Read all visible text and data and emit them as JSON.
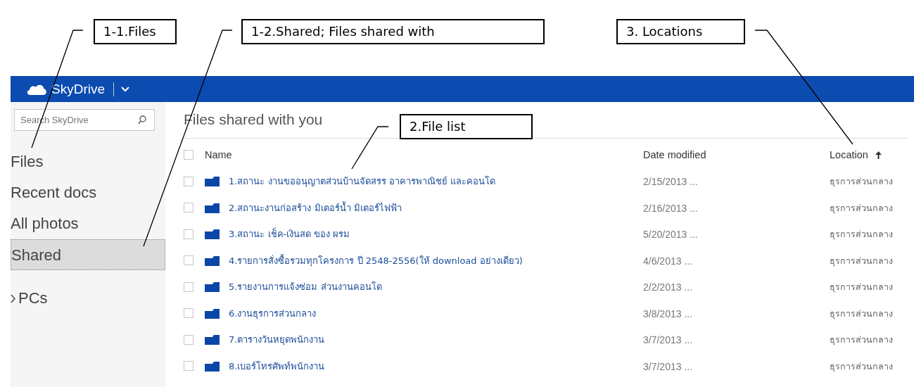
{
  "callouts": [
    {
      "label": "1-1.Files"
    },
    {
      "label": "1-2.Shared; Files shared with"
    },
    {
      "label": "3. Locations"
    },
    {
      "label": "2.File list"
    }
  ],
  "app_bar": {
    "title": "SkyDrive"
  },
  "sidebar": {
    "search": {
      "placeholder": "Search SkyDrive"
    },
    "items": [
      {
        "label": "Files",
        "selected": false
      },
      {
        "label": "Recent docs",
        "selected": false
      },
      {
        "label": "All photos",
        "selected": false
      },
      {
        "label": "Shared",
        "selected": true
      }
    ],
    "groups": [
      {
        "label": "PCs",
        "expanded": false
      }
    ]
  },
  "main": {
    "title": "Files shared with you",
    "columns": [
      {
        "label": "Name",
        "sorted": false
      },
      {
        "label": "Date modified",
        "sorted": false
      },
      {
        "label": "Location",
        "sorted": true
      }
    ],
    "select_all": {
      "checked": false
    },
    "rows": [
      {
        "name": "1.สถานะ งานขออนุญาตส่วนบ้านจัดสรร อาคารพาณิชย์ และคอนโด",
        "date": "2/15/2013 ...",
        "location": "ธุรการส่วนกลาง",
        "checked": false
      },
      {
        "name": "2.สถานะงานก่อสร้าง มิเตอร์น้ำ มิเตอร์ไฟฟ้า",
        "date": "2/16/2013 ...",
        "location": "ธุรการส่วนกลาง",
        "checked": false
      },
      {
        "name": "3.สถานะ เช็ค-เงินสด ของ ผรม",
        "date": "5/20/2013 ...",
        "location": "ธุรการส่วนกลาง",
        "checked": false
      },
      {
        "name": "4.รายการสั่งซื้อรวมทุกโครงการ ปี 2548-2556(ให้ download อย่างเดียว)",
        "date": "4/6/2013 ...",
        "location": "ธุรการส่วนกลาง",
        "checked": false
      },
      {
        "name": "5.รายงานการแจ้งซ่อม ส่วนงานคอนโด",
        "date": "2/2/2013 ...",
        "location": "ธุรการส่วนกลาง",
        "checked": false
      },
      {
        "name": "6.งานธุรการส่วนกลาง",
        "date": "3/8/2013 ...",
        "location": "ธุรการส่วนกลาง",
        "checked": false
      },
      {
        "name": "7.ตารางวันหยุดพนักงาน",
        "date": "3/7/2013 ...",
        "location": "ธุรการส่วนกลาง",
        "checked": false
      },
      {
        "name": "8.เบอร์โทรศัพท์พนักงาน",
        "date": "3/7/2013 ...",
        "location": "ธุรการส่วนกลาง",
        "checked": false
      }
    ]
  }
}
